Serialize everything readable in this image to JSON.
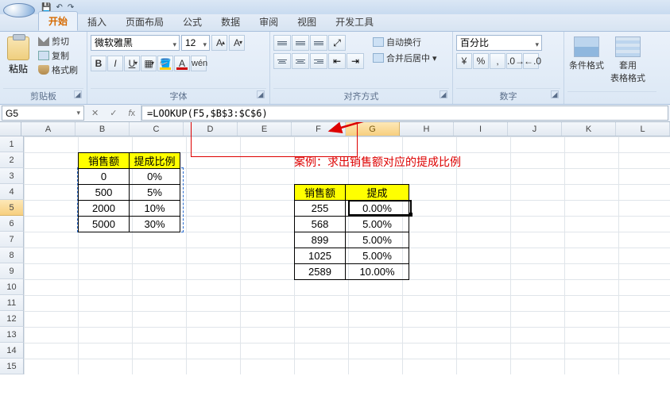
{
  "tabs": {
    "home": "开始",
    "insert": "插入",
    "layout": "页面布局",
    "formula": "公式",
    "data": "数据",
    "review": "审阅",
    "view": "视图",
    "dev": "开发工具"
  },
  "clipboard": {
    "paste": "粘贴",
    "cut": "剪切",
    "copy": "复制",
    "format_painter": "格式刷",
    "group": "剪贴板"
  },
  "font": {
    "name": "微软雅黑",
    "size": "12",
    "group": "字体"
  },
  "alignment": {
    "wrap": "自动换行",
    "merge": "合并后居中",
    "group": "对齐方式"
  },
  "number": {
    "format": "百分比",
    "group": "数字"
  },
  "styles": {
    "cond": "条件格式",
    "table": "套用\n表格格式"
  },
  "namebox": "G5",
  "formula": "=LOOKUP(F5,$B$3:$C$6)",
  "cols": [
    "A",
    "B",
    "C",
    "D",
    "E",
    "F",
    "G",
    "H",
    "I",
    "J",
    "K",
    "L"
  ],
  "rows": [
    "1",
    "2",
    "3",
    "4",
    "5",
    "6",
    "7",
    "8",
    "9",
    "10",
    "11",
    "12",
    "13",
    "14",
    "15"
  ],
  "caption": "案例：求出销售额对应的提成比例",
  "table1": {
    "h1": "销售额",
    "h2": "提成比例",
    "rows": [
      {
        "a": "0",
        "b": "0%"
      },
      {
        "a": "500",
        "b": "5%"
      },
      {
        "a": "2000",
        "b": "10%"
      },
      {
        "a": "5000",
        "b": "30%"
      }
    ]
  },
  "table2": {
    "h1": "销售额",
    "h2": "提成",
    "rows": [
      {
        "a": "255",
        "b": "0.00%"
      },
      {
        "a": "568",
        "b": "5.00%"
      },
      {
        "a": "899",
        "b": "5.00%"
      },
      {
        "a": "1025",
        "b": "5.00%"
      },
      {
        "a": "2589",
        "b": "10.00%"
      }
    ]
  }
}
